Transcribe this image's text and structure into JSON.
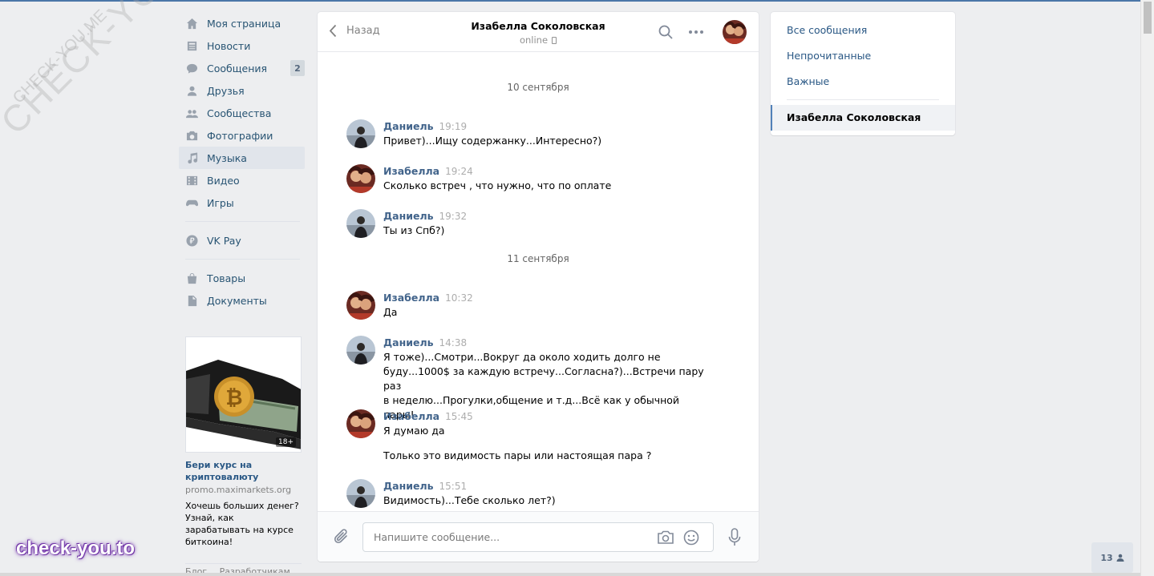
{
  "watermark": {
    "diagonal_large": "CHECK-YOU.ME",
    "diagonal_small": "CHECK-YOU.ME",
    "bottom": "check-you.to"
  },
  "nav": {
    "items": [
      {
        "label": "Моя страница",
        "icon": "home-icon"
      },
      {
        "label": "Новости",
        "icon": "news-icon"
      },
      {
        "label": "Сообщения",
        "icon": "messages-icon",
        "counter": "2"
      },
      {
        "label": "Друзья",
        "icon": "user-icon"
      },
      {
        "label": "Сообщества",
        "icon": "users-icon"
      },
      {
        "label": "Фотографии",
        "icon": "camera-icon"
      },
      {
        "label": "Музыка",
        "icon": "music-icon",
        "active": true
      },
      {
        "label": "Видео",
        "icon": "video-icon"
      },
      {
        "label": "Игры",
        "icon": "gamepad-icon"
      },
      {
        "label": "VK Pay",
        "icon": "rouble-icon"
      },
      {
        "label": "Товары",
        "icon": "bag-icon"
      },
      {
        "label": "Документы",
        "icon": "document-icon"
      }
    ]
  },
  "ad": {
    "title": "Бери курс на криптовалюту",
    "domain": "promo.maximarkets.org",
    "text": "Хочешь больших денег? Узнай, как зарабатывать на курсе биткоина!",
    "age": "18+"
  },
  "footer": {
    "links": [
      "Блог",
      "Разработчикам"
    ]
  },
  "chat": {
    "back_label": "Назад",
    "peer_name": "Изабелла Соколовская",
    "peer_status": "online",
    "composer_placeholder": "Напишите сообщение...",
    "dates": [
      "10 сентября",
      "11 сентября"
    ],
    "messages": [
      {
        "author": "Даниель",
        "time": "19:19",
        "avatar": "daniel",
        "text": "Привет)...Ищу содержанку...Интересно?)"
      },
      {
        "author": "Изабелла",
        "time": "19:24",
        "avatar": "izabella",
        "text": "Сколько встреч , что нужно, что по оплате"
      },
      {
        "author": "Даниель",
        "time": "19:32",
        "avatar": "daniel",
        "text": "Ты из Спб?)"
      },
      {
        "author": "Изабелла",
        "time": "10:32",
        "avatar": "izabella",
        "text": "Да"
      },
      {
        "author": "Даниель",
        "time": "14:38",
        "avatar": "daniel",
        "lines": [
          "Я тоже)...Смотри...Вокруг да около ходить долго не",
          "буду...1000$ за каждую встречу...Согласна?)...Встречи пару раз",
          "в неделю...Прогулки,общение и т.д...Всё как у обычной пары!"
        ]
      },
      {
        "author": "Изабелла",
        "time": "15:45",
        "avatar": "izabella",
        "text": "Я думаю да",
        "text2": "Только это видимость пары или настоящая пара ?"
      },
      {
        "author": "Даниель",
        "time": "15:51",
        "avatar": "daniel",
        "text": "Видимость)...Тебе сколько лет?)"
      }
    ]
  },
  "right_panel": {
    "items": [
      "Все сообщения",
      "Непрочитанные",
      "Важные"
    ],
    "active_dialog": "Изабелла Соколовская"
  },
  "friends_badge": {
    "count": "13"
  },
  "colors": {
    "accent": "#4a76a8",
    "link": "#2a5885",
    "author": "#42648b",
    "background": "#edeef0"
  }
}
